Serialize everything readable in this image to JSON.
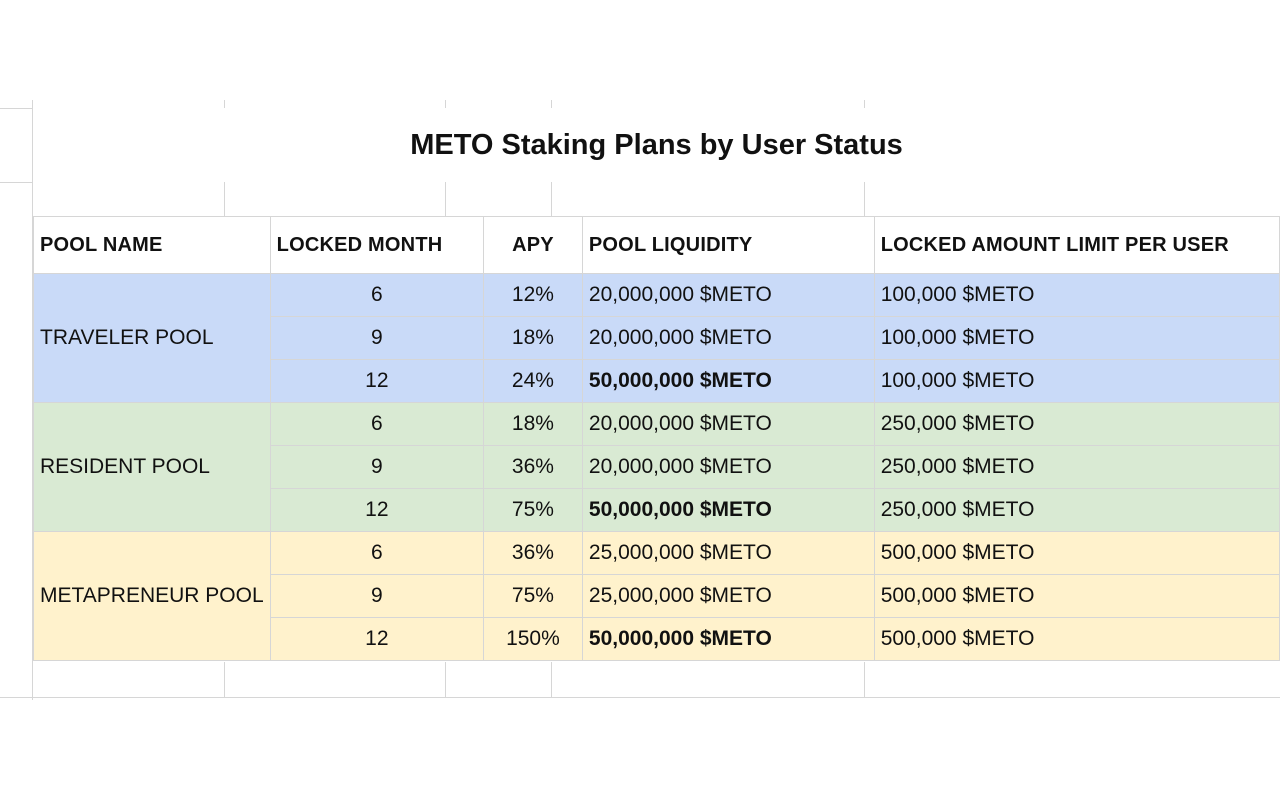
{
  "title": "METO Staking Plans by User Status",
  "headers": [
    "POOL NAME",
    "LOCKED MONTH",
    "APY",
    "POOL LIQUIDITY",
    "LOCKED AMOUNT LIMIT PER USER"
  ],
  "pools": [
    {
      "name": "TRAVELER POOL",
      "color": "#c9daf8",
      "rows": [
        {
          "month": "6",
          "apy": "12%",
          "liquidity": "20,000,000 $METO",
          "liquidity_bold": false,
          "limit": "100,000 $METO"
        },
        {
          "month": "9",
          "apy": "18%",
          "liquidity": "20,000,000 $METO",
          "liquidity_bold": false,
          "limit": "100,000 $METO"
        },
        {
          "month": "12",
          "apy": "24%",
          "liquidity": "50,000,000 $METO",
          "liquidity_bold": true,
          "limit": "100,000 $METO"
        }
      ]
    },
    {
      "name": "RESIDENT POOL",
      "color": "#d9ead3",
      "rows": [
        {
          "month": "6",
          "apy": "18%",
          "liquidity": "20,000,000 $METO",
          "liquidity_bold": false,
          "limit": "250,000 $METO"
        },
        {
          "month": "9",
          "apy": "36%",
          "liquidity": "20,000,000 $METO",
          "liquidity_bold": false,
          "limit": "250,000 $METO"
        },
        {
          "month": "12",
          "apy": "75%",
          "liquidity": "50,000,000 $METO",
          "liquidity_bold": true,
          "limit": "250,000 $METO"
        }
      ]
    },
    {
      "name": "METAPRENEUR POOL",
      "color": "#fff2cc",
      "rows": [
        {
          "month": "6",
          "apy": "36%",
          "liquidity": "25,000,000 $METO",
          "liquidity_bold": false,
          "limit": "500,000 $METO"
        },
        {
          "month": "9",
          "apy": "75%",
          "liquidity": "25,000,000 $METO",
          "liquidity_bold": false,
          "limit": "500,000 $METO"
        },
        {
          "month": "12",
          "apy": "150%",
          "liquidity": "50,000,000 $METO",
          "liquidity_bold": true,
          "limit": "500,000 $METO"
        }
      ]
    }
  ]
}
